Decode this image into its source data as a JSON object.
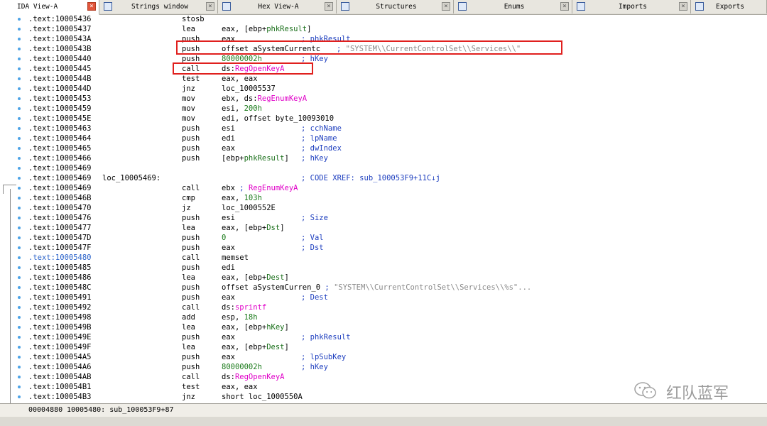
{
  "tabs": [
    {
      "label": "IDA View-A",
      "icon": "ida-view-icon",
      "close": "×",
      "active": true
    },
    {
      "label": "Strings window",
      "icon": "strings-icon",
      "close": "×"
    },
    {
      "label": "Hex View-A",
      "icon": "hex-view-icon",
      "close": "×"
    },
    {
      "label": "Structures",
      "icon": "structures-icon",
      "close": "×"
    },
    {
      "label": "Enums",
      "icon": "enums-icon",
      "close": "×"
    },
    {
      "label": "Imports",
      "icon": "imports-icon",
      "close": "×"
    },
    {
      "label": "Exports",
      "icon": "exports-icon"
    }
  ],
  "listing": [
    {
      "addr": ".text:10005436",
      "mnem": "stosb",
      "ops": []
    },
    {
      "addr": ".text:10005437",
      "mnem": "lea",
      "ops": [
        {
          "t": "eax, [ebp+"
        },
        {
          "t": "phkResult",
          "c": "var"
        },
        {
          "t": "]"
        }
      ]
    },
    {
      "addr": ".text:1000543A",
      "mnem": "push",
      "ops": [
        {
          "t": "eax"
        }
      ],
      "cmt": "; phkResult"
    },
    {
      "addr": ".text:1000543B",
      "mnem": "push",
      "ops": [
        {
          "t": "offset aSystemCurrentc"
        }
      ],
      "cmt2": [
        {
          "t": "; "
        },
        {
          "t": "\"SYSTEM\\\\CurrentControlSet\\\\Services\\\\\"",
          "c": "str"
        }
      ]
    },
    {
      "addr": ".text:10005440",
      "mnem": "push",
      "ops": [
        {
          "t": "80000002h",
          "c": "num"
        }
      ],
      "cmt": "; hKey"
    },
    {
      "addr": ".text:10005445",
      "mnem": "call",
      "ops": [
        {
          "t": "ds:"
        },
        {
          "t": "RegOpenKeyA",
          "c": "imp"
        }
      ]
    },
    {
      "addr": ".text:1000544B",
      "mnem": "test",
      "ops": [
        {
          "t": "eax, eax"
        }
      ]
    },
    {
      "addr": ".text:1000544D",
      "mnem": "jnz",
      "ops": [
        {
          "t": "loc_10005537"
        }
      ]
    },
    {
      "addr": ".text:10005453",
      "mnem": "mov",
      "ops": [
        {
          "t": "ebx, ds:"
        },
        {
          "t": "RegEnumKeyA",
          "c": "imp"
        }
      ]
    },
    {
      "addr": ".text:10005459",
      "mnem": "mov",
      "ops": [
        {
          "t": "esi, "
        },
        {
          "t": "200h",
          "c": "num"
        }
      ]
    },
    {
      "addr": ".text:1000545E",
      "mnem": "mov",
      "ops": [
        {
          "t": "edi, offset byte_10093010"
        }
      ]
    },
    {
      "addr": ".text:10005463",
      "mnem": "push",
      "ops": [
        {
          "t": "esi"
        }
      ],
      "cmt": "; cchName"
    },
    {
      "addr": ".text:10005464",
      "mnem": "push",
      "ops": [
        {
          "t": "edi"
        }
      ],
      "cmt": "; lpName"
    },
    {
      "addr": ".text:10005465",
      "mnem": "push",
      "ops": [
        {
          "t": "eax"
        }
      ],
      "cmt": "; dwIndex"
    },
    {
      "addr": ".text:10005466",
      "mnem": "push",
      "ops": [
        {
          "t": "[ebp+"
        },
        {
          "t": "phkResult",
          "c": "var"
        },
        {
          "t": "]"
        }
      ],
      "cmt": "; hKey"
    },
    {
      "addr": ".text:10005469",
      "mnem": "",
      "ops": []
    },
    {
      "addr": ".text:10005469",
      "label": "loc_10005469:",
      "mnem": "",
      "ops": [],
      "xref": "; CODE XREF: sub_100053F9+11C↓j"
    },
    {
      "addr": ".text:10005469",
      "mnem": "call",
      "ops": [
        {
          "t": "ebx "
        },
        {
          "t": "; ",
          "c": "cmtc"
        },
        {
          "t": "RegEnumKeyA",
          "c": "imp"
        }
      ]
    },
    {
      "addr": ".text:1000546B",
      "mnem": "cmp",
      "ops": [
        {
          "t": "eax, "
        },
        {
          "t": "103h",
          "c": "num"
        }
      ]
    },
    {
      "addr": ".text:10005470",
      "mnem": "jz",
      "ops": [
        {
          "t": "loc_1000552E"
        }
      ]
    },
    {
      "addr": ".text:10005476",
      "mnem": "push",
      "ops": [
        {
          "t": "esi"
        }
      ],
      "cmt": "; Size"
    },
    {
      "addr": ".text:10005477",
      "mnem": "lea",
      "ops": [
        {
          "t": "eax, [ebp+"
        },
        {
          "t": "Dst",
          "c": "var"
        },
        {
          "t": "]"
        }
      ]
    },
    {
      "addr": ".text:1000547D",
      "mnem": "push",
      "ops": [
        {
          "t": "0",
          "c": "num"
        }
      ],
      "cmt": "; Val"
    },
    {
      "addr": ".text:1000547F",
      "mnem": "push",
      "ops": [
        {
          "t": "eax"
        }
      ],
      "cmt": "; Dst"
    },
    {
      "addr": ".text:10005480",
      "mnem": "call",
      "ops": [
        {
          "t": "memset"
        }
      ],
      "sel": true
    },
    {
      "addr": ".text:10005485",
      "mnem": "push",
      "ops": [
        {
          "t": "edi"
        }
      ]
    },
    {
      "addr": ".text:10005486",
      "mnem": "lea",
      "ops": [
        {
          "t": "eax, [ebp+"
        },
        {
          "t": "Dest",
          "c": "var"
        },
        {
          "t": "]"
        }
      ]
    },
    {
      "addr": ".text:1000548C",
      "mnem": "push",
      "ops": [
        {
          "t": "offset aSystemCurren_0 "
        },
        {
          "t": "; ",
          "c": "cmtc"
        },
        {
          "t": "\"SYSTEM\\\\CurrentControlSet\\\\Services\\\\%s\"...",
          "c": "str"
        }
      ]
    },
    {
      "addr": ".text:10005491",
      "mnem": "push",
      "ops": [
        {
          "t": "eax"
        }
      ],
      "cmt": "; Dest"
    },
    {
      "addr": ".text:10005492",
      "mnem": "call",
      "ops": [
        {
          "t": "ds:"
        },
        {
          "t": "sprintf",
          "c": "imp"
        }
      ]
    },
    {
      "addr": ".text:10005498",
      "mnem": "add",
      "ops": [
        {
          "t": "esp, "
        },
        {
          "t": "18h",
          "c": "num"
        }
      ]
    },
    {
      "addr": ".text:1000549B",
      "mnem": "lea",
      "ops": [
        {
          "t": "eax, [ebp+"
        },
        {
          "t": "hKey",
          "c": "var"
        },
        {
          "t": "]"
        }
      ]
    },
    {
      "addr": ".text:1000549E",
      "mnem": "push",
      "ops": [
        {
          "t": "eax"
        }
      ],
      "cmt": "; phkResult"
    },
    {
      "addr": ".text:1000549F",
      "mnem": "lea",
      "ops": [
        {
          "t": "eax, [ebp+"
        },
        {
          "t": "Dest",
          "c": "var"
        },
        {
          "t": "]"
        }
      ]
    },
    {
      "addr": ".text:100054A5",
      "mnem": "push",
      "ops": [
        {
          "t": "eax"
        }
      ],
      "cmt": "; lpSubKey"
    },
    {
      "addr": ".text:100054A6",
      "mnem": "push",
      "ops": [
        {
          "t": "80000002h",
          "c": "num"
        }
      ],
      "cmt": "; hKey"
    },
    {
      "addr": ".text:100054AB",
      "mnem": "call",
      "ops": [
        {
          "t": "ds:"
        },
        {
          "t": "RegOpenKeyA",
          "c": "imp"
        }
      ]
    },
    {
      "addr": ".text:100054B1",
      "mnem": "test",
      "ops": [
        {
          "t": "eax, eax"
        }
      ]
    },
    {
      "addr": ".text:100054B3",
      "mnem": "jnz",
      "ops": [
        {
          "t": "short loc_1000550A"
        }
      ]
    }
  ],
  "status": {
    "offset": "00004880",
    "location": "10005480: sub_100053F9+87"
  },
  "watermark": {
    "text": "红队蓝军"
  },
  "colors": {
    "highlight_box": "#e0201e",
    "import": "#e000c8",
    "comment": "#1e3fbf",
    "string": "#8a8a8a",
    "var": "#1a6f1a"
  }
}
